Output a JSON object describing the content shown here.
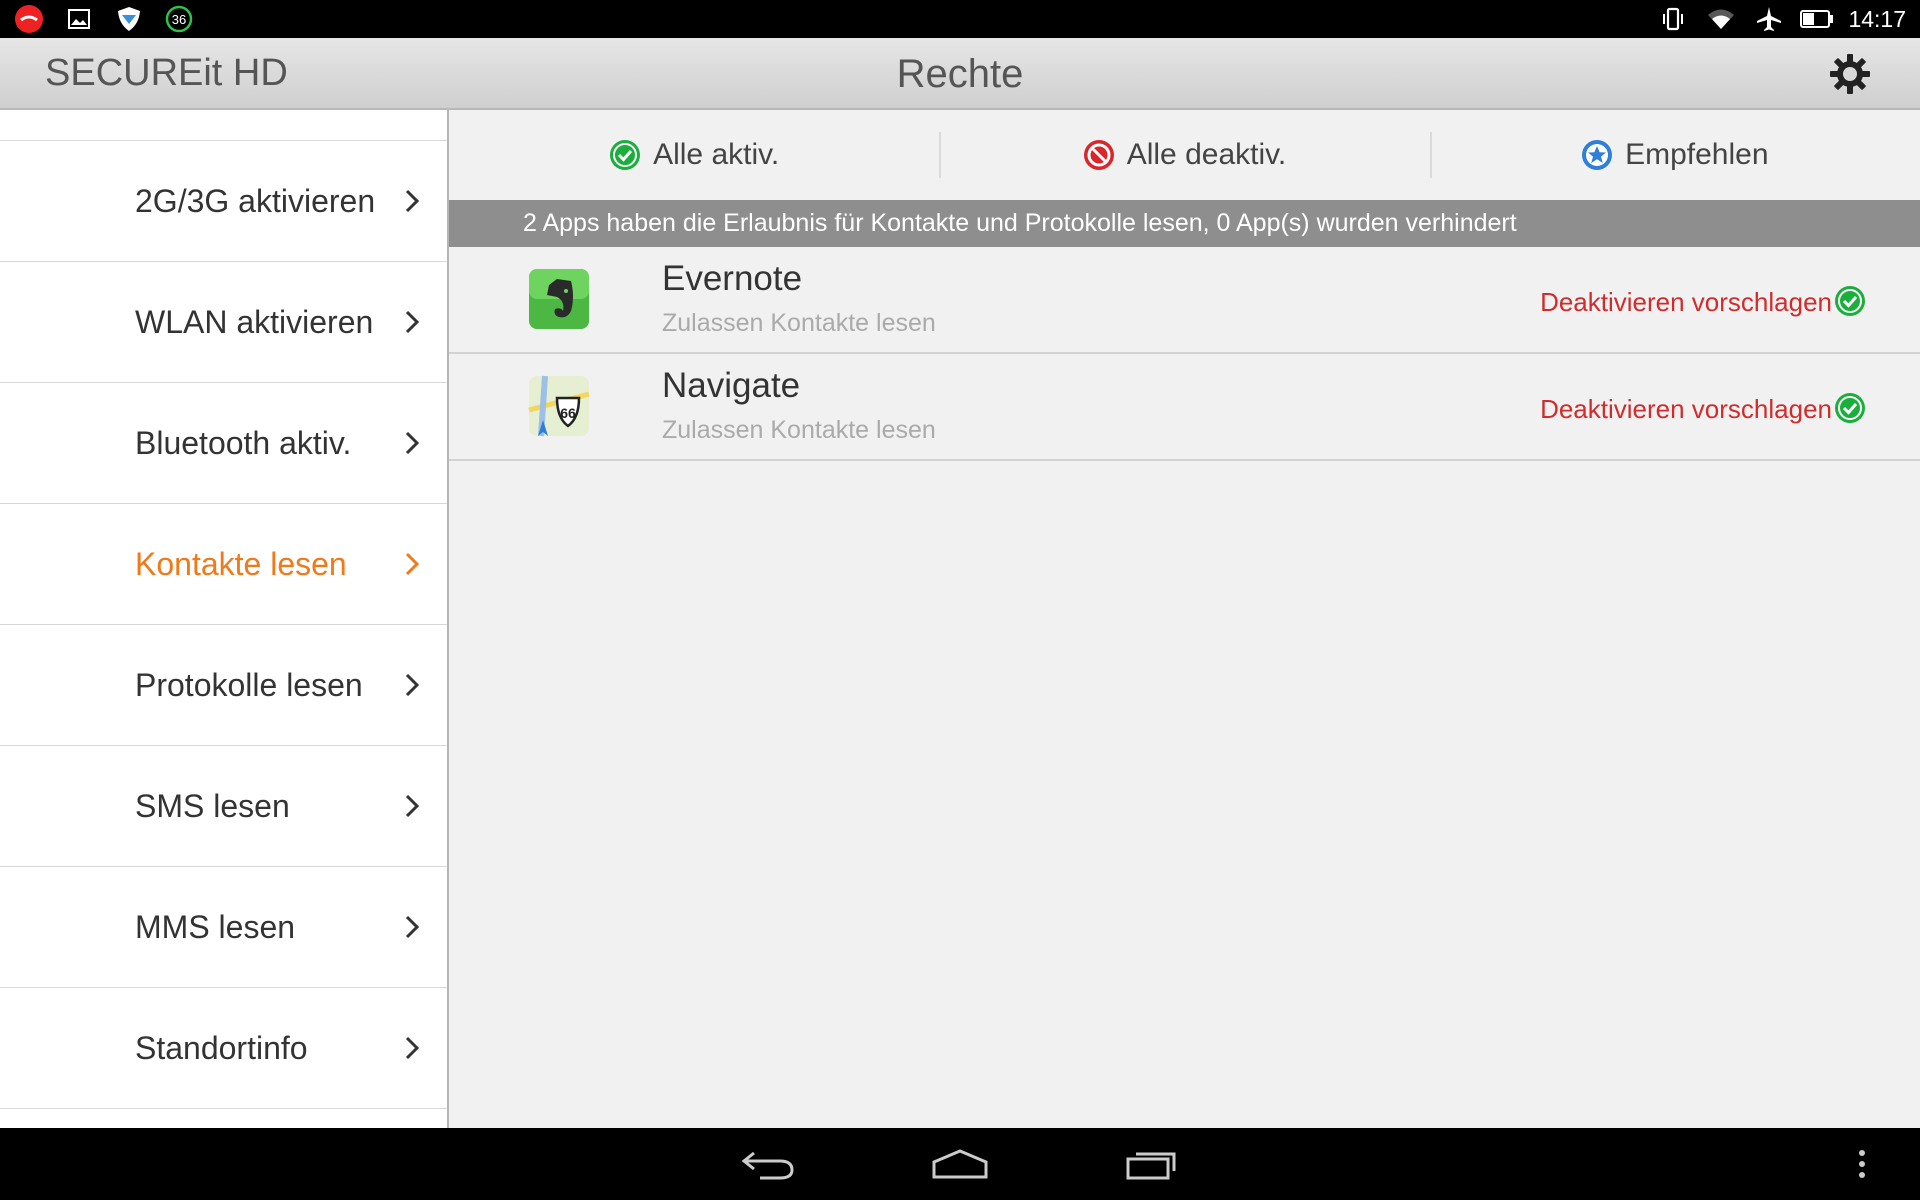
{
  "status_bar": {
    "time": "14:17",
    "notification_badge": "36",
    "left_icons": [
      "missed-call-icon",
      "image-icon",
      "shield-icon",
      "speed-badge-icon"
    ],
    "right_icons": [
      "vibrate-icon",
      "wifi-icon",
      "airplane-icon",
      "battery-icon"
    ]
  },
  "action_bar": {
    "app_title": "SECUREit HD",
    "page_title": "Rechte",
    "settings_icon": "gear-icon"
  },
  "sidebar": {
    "items": [
      {
        "label": "2G/3G aktivieren",
        "active": false
      },
      {
        "label": "WLAN aktivieren",
        "active": false
      },
      {
        "label": "Bluetooth aktiv.",
        "active": false
      },
      {
        "label": "Kontakte lesen",
        "active": true
      },
      {
        "label": "Protokolle lesen",
        "active": false
      },
      {
        "label": "SMS lesen",
        "active": false
      },
      {
        "label": "MMS lesen",
        "active": false
      },
      {
        "label": "Standortinfo",
        "active": false
      }
    ],
    "active_color": "#f07a19"
  },
  "toolbar": {
    "enable_all": "Alle aktiv.",
    "disable_all": "Alle deaktiv.",
    "recommend": "Empfehlen"
  },
  "banner": {
    "text": "2 Apps haben die Erlaubnis für Kontakte und Protokolle lesen, 0 App(s) wurden verhindert"
  },
  "apps": [
    {
      "name": "Evernote",
      "permission": "Zulassen Kontakte lesen",
      "action": "Deaktivieren vorschlagen",
      "icon": "evernote-icon"
    },
    {
      "name": "Navigate",
      "permission": "Zulassen Kontakte lesen",
      "action": "Deaktivieren vorschlagen",
      "icon": "navigate-icon"
    }
  ],
  "colors": {
    "accent": "#f07a19",
    "warning_text": "#cf2d2d",
    "check_green": "#1aae3c",
    "block_red": "#d9262b",
    "recommend_blue": "#2f7fd8",
    "banner_bg": "#8e8e8e"
  },
  "nav_bar": {
    "icons": [
      "back-icon",
      "home-icon",
      "recent-apps-icon",
      "overflow-menu-icon"
    ]
  }
}
